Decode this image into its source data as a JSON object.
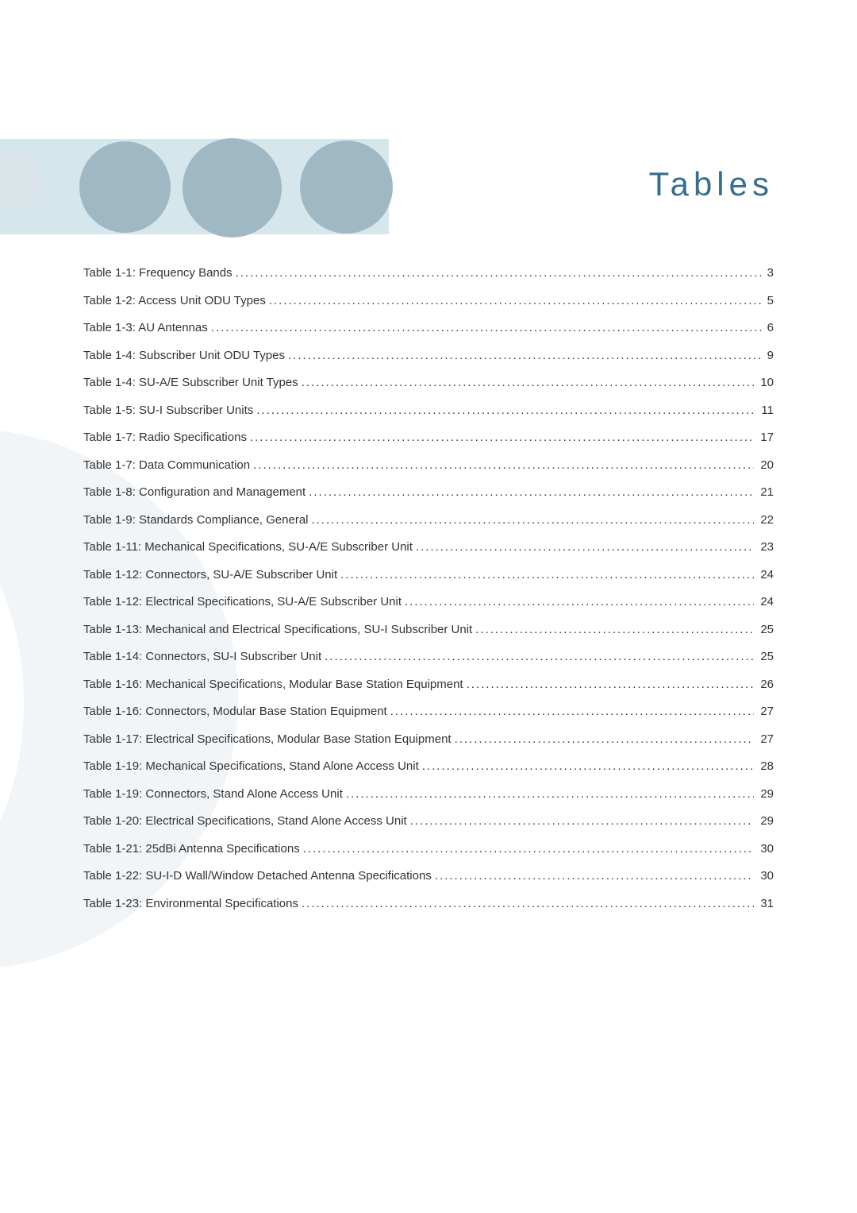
{
  "title": "Tables",
  "toc": [
    {
      "label": "Table 1-1: Frequency Bands",
      "page": "3"
    },
    {
      "label": "Table 1-2: Access Unit ODU Types",
      "page": "5"
    },
    {
      "label": "Table 1-3: AU Antennas",
      "page": "6"
    },
    {
      "label": "Table 1-4: Subscriber Unit ODU Types",
      "page": "9"
    },
    {
      "label": "Table 1-4: SU-A/E Subscriber Unit Types",
      "page": "10"
    },
    {
      "label": "Table 1-5: SU-I Subscriber Units",
      "page": "11"
    },
    {
      "label": "Table 1-7: Radio Specifications",
      "page": "17"
    },
    {
      "label": "Table 1-7: Data Communication",
      "page": "20"
    },
    {
      "label": "Table 1-8: Configuration and Management",
      "page": "21"
    },
    {
      "label": "Table 1-9: Standards Compliance, General",
      "page": "22"
    },
    {
      "label": "Table 1-11: Mechanical Specifications, SU-A/E Subscriber Unit",
      "page": "23"
    },
    {
      "label": "Table 1-12: Connectors, SU-A/E Subscriber Unit",
      "page": "24"
    },
    {
      "label": "Table 1-12: Electrical Specifications, SU-A/E Subscriber Unit",
      "page": "24"
    },
    {
      "label": "Table 1-13: Mechanical and Electrical Specifications, SU-I Subscriber Unit",
      "page": "25"
    },
    {
      "label": "Table 1-14: Connectors, SU-I Subscriber Unit",
      "page": "25"
    },
    {
      "label": "Table 1-16: Mechanical Specifications, Modular Base Station Equipment",
      "page": "26"
    },
    {
      "label": "Table 1-16: Connectors, Modular Base Station Equipment",
      "page": "27"
    },
    {
      "label": "Table 1-17: Electrical Specifications, Modular Base Station Equipment",
      "page": "27"
    },
    {
      "label": "Table 1-19: Mechanical Specifications, Stand Alone Access Unit",
      "page": "28"
    },
    {
      "label": "Table 1-19: Connectors, Stand Alone Access Unit",
      "page": "29"
    },
    {
      "label": "Table 1-20: Electrical Specifications, Stand Alone Access Unit",
      "page": "29"
    },
    {
      "label": "Table 1-21: 25dBi Antenna Specifications",
      "page": "30"
    },
    {
      "label": "Table 1-22: SU-I-D Wall/Window Detached Antenna Specifications",
      "page": "30"
    },
    {
      "label": "Table 1-23: Environmental Specifications",
      "page": "31"
    }
  ]
}
